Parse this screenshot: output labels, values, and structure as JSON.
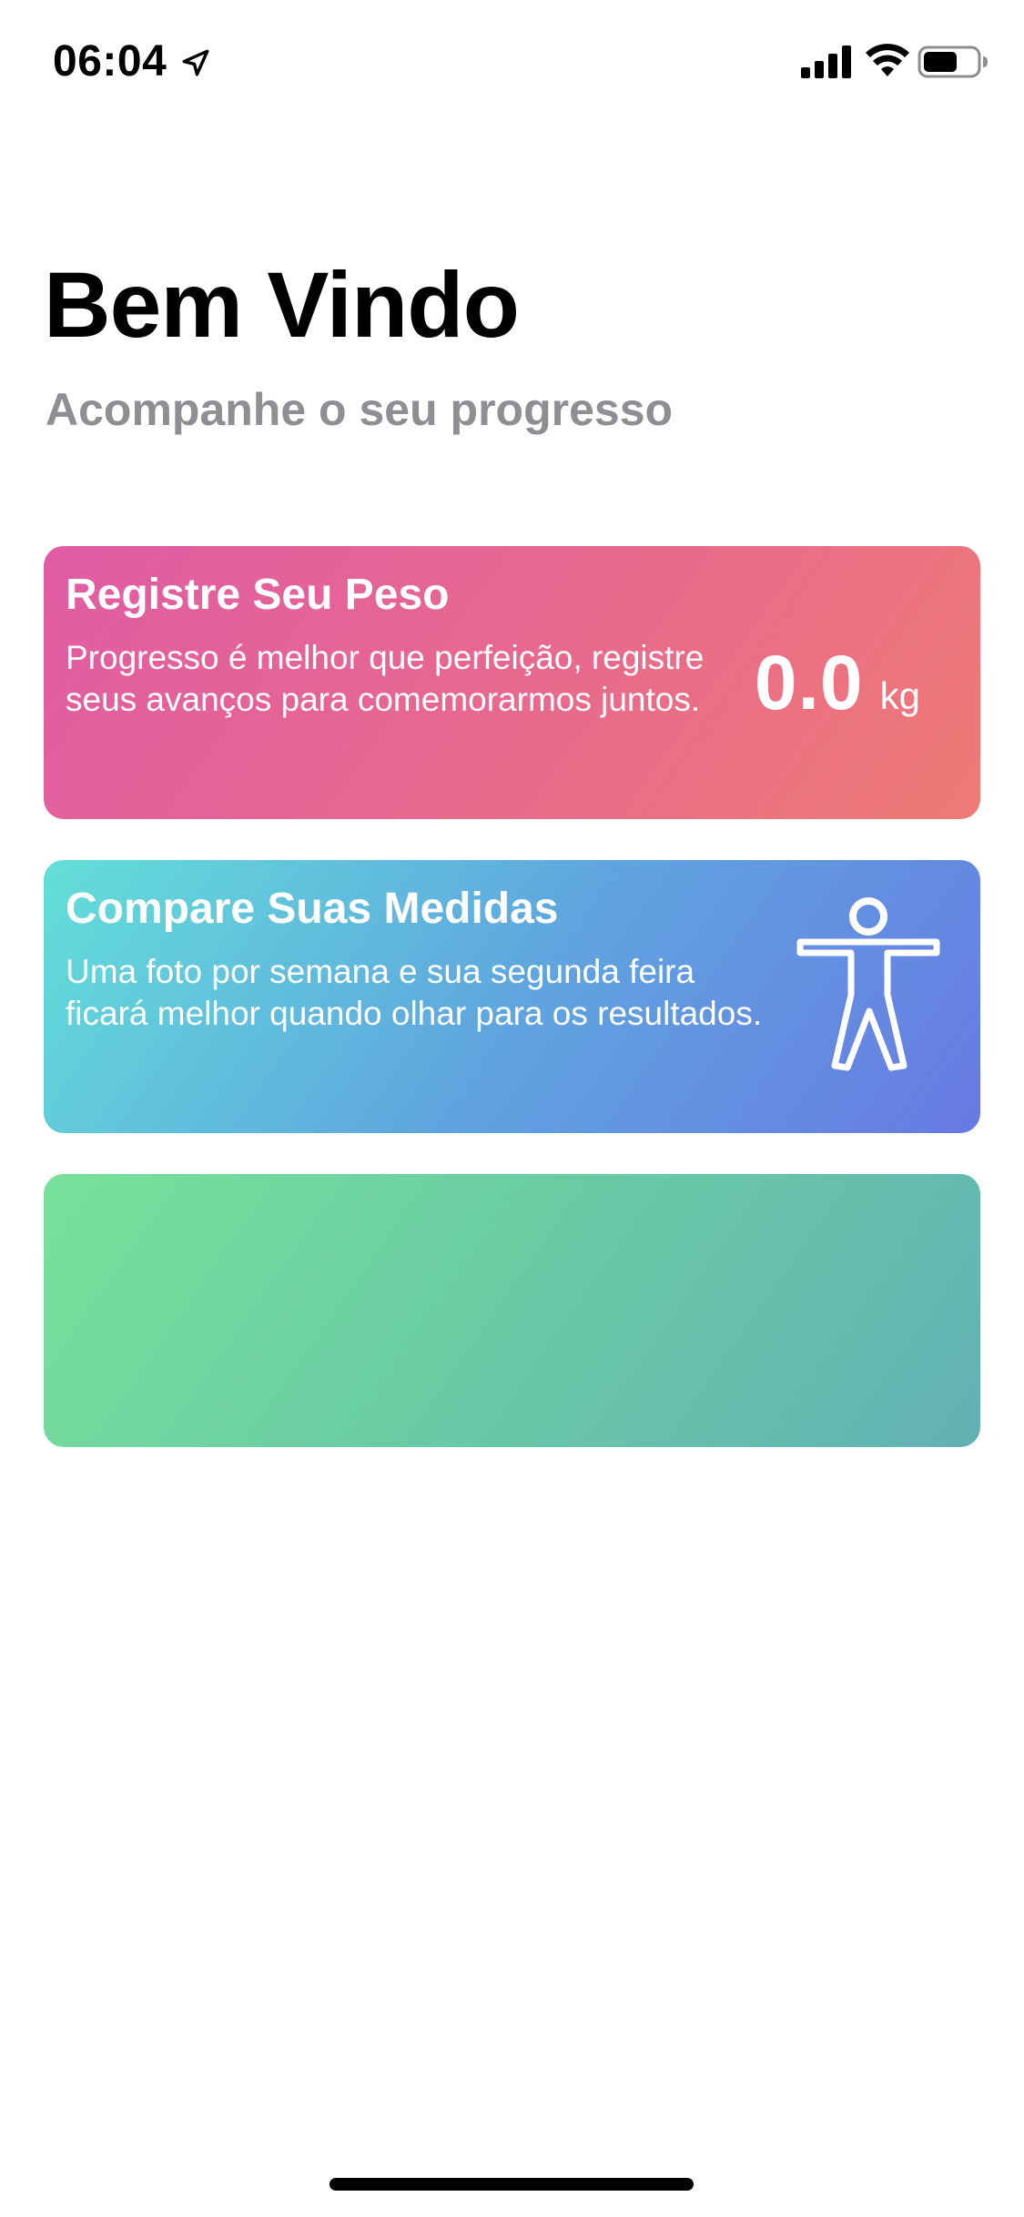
{
  "status_bar": {
    "time": "06:04",
    "icons": [
      "location-arrow-icon",
      "cellular-signal-icon",
      "wifi-icon",
      "battery-icon"
    ]
  },
  "header": {
    "title": "Bem Vindo",
    "subtitle": "Acompanhe o seu progresso"
  },
  "cards": {
    "weight": {
      "title": "Registre Seu Peso",
      "description": "Progresso é melhor que perfeição, registre seus avanços para comemorarmos juntos.",
      "value": "0.0",
      "unit": "kg",
      "gradient": [
        "#e05ca4",
        "#ef7a74"
      ]
    },
    "measures": {
      "title": "Compare Suas Medidas",
      "description": "Uma foto por semana e sua segunda feira ficará melhor quando olhar para os resultados.",
      "icon": "body-figure-icon",
      "gradient": [
        "#63dfd8",
        "#6879e3"
      ]
    },
    "empty": {
      "gradient": [
        "#78e19a",
        "#62b1b5"
      ]
    }
  },
  "colors": {
    "title": "#000000",
    "subtitle": "#8e8e93",
    "background": "#ffffff"
  }
}
